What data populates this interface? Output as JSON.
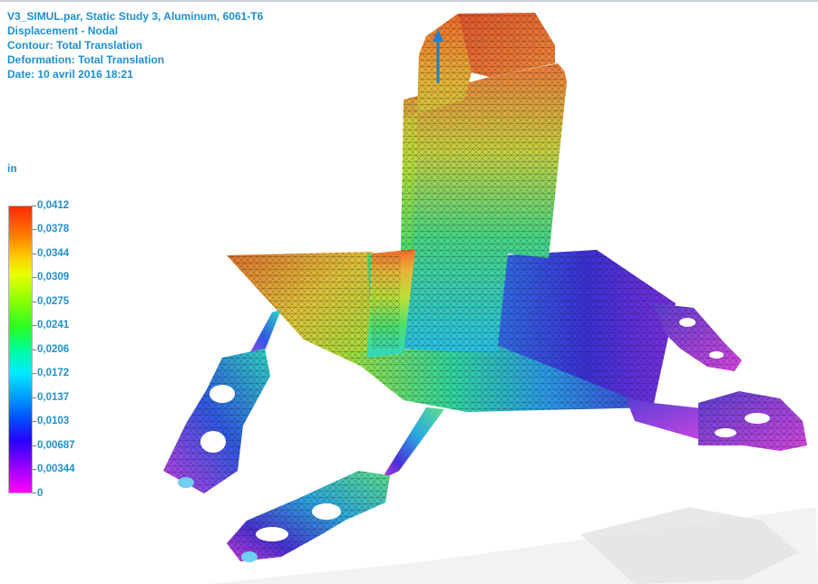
{
  "header": {
    "line1": "V3_SIMUL.par, Static Study 3, Aluminum, 6061-T6",
    "line2": "Displacement - Nodal",
    "line3": "Contour: Total Translation",
    "line4": "Deformation: Total Translation",
    "line5": "Date: 10 avril 2016  18:21"
  },
  "legend": {
    "unit": "in",
    "ticks": [
      "0,0412",
      "0,0378",
      "0,0344",
      "0,0309",
      "0,0275",
      "0,0241",
      "0,0206",
      "0,0172",
      "0,0137",
      "0,0103",
      "0,00687",
      "0,00344",
      "0"
    ]
  },
  "colors": {
    "label_text": "#1f8fd2",
    "max_color": "#ff2a00",
    "min_color": "#ff00ff"
  }
}
